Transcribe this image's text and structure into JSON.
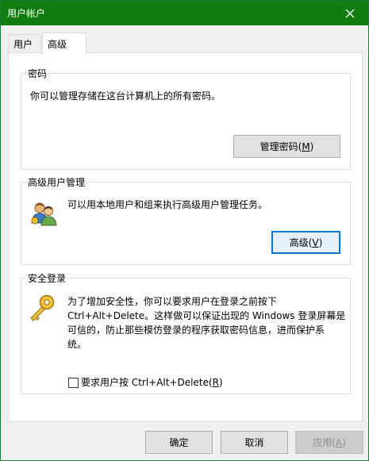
{
  "window": {
    "title": "用户帐户"
  },
  "tabs": [
    {
      "label": "用户"
    },
    {
      "label": "高级"
    }
  ],
  "passwords": {
    "legend": "密码",
    "description": "你可以管理存储在这台计算机上的所有密码。",
    "button_text": "管理密码(",
    "button_key": "M",
    "button_close": ")"
  },
  "advanced_user": {
    "legend": "高级用户管理",
    "description": "可以用本地用户和组来执行高级用户管理任务。",
    "button_text": "高级(",
    "button_key": "V",
    "button_close": ")"
  },
  "secure_logon": {
    "legend": "安全登录",
    "description_lines": [
      "为了增加安全性，你可以要求用户在登录之前按下",
      "Ctrl+Alt+Delete。这样做可以保证出现的 Windows 登录屏幕是",
      "可信的，防止那些模仿登录的程序获取密码信息，进而保护系",
      "统。"
    ],
    "checkbox_text": "要求用户按 Ctrl+Alt+Delete(",
    "checkbox_key": "R",
    "checkbox_close": ")",
    "checkbox_checked": false
  },
  "footer": {
    "ok": "确定",
    "cancel": "取消",
    "apply_text": "应用(",
    "apply_key": "A",
    "apply_close": ")"
  },
  "icons": {
    "close": "close-icon",
    "users": "users-icon",
    "key": "key-icon"
  },
  "colors": {
    "titlebar": "#107c10",
    "focus": "#0078d7"
  }
}
